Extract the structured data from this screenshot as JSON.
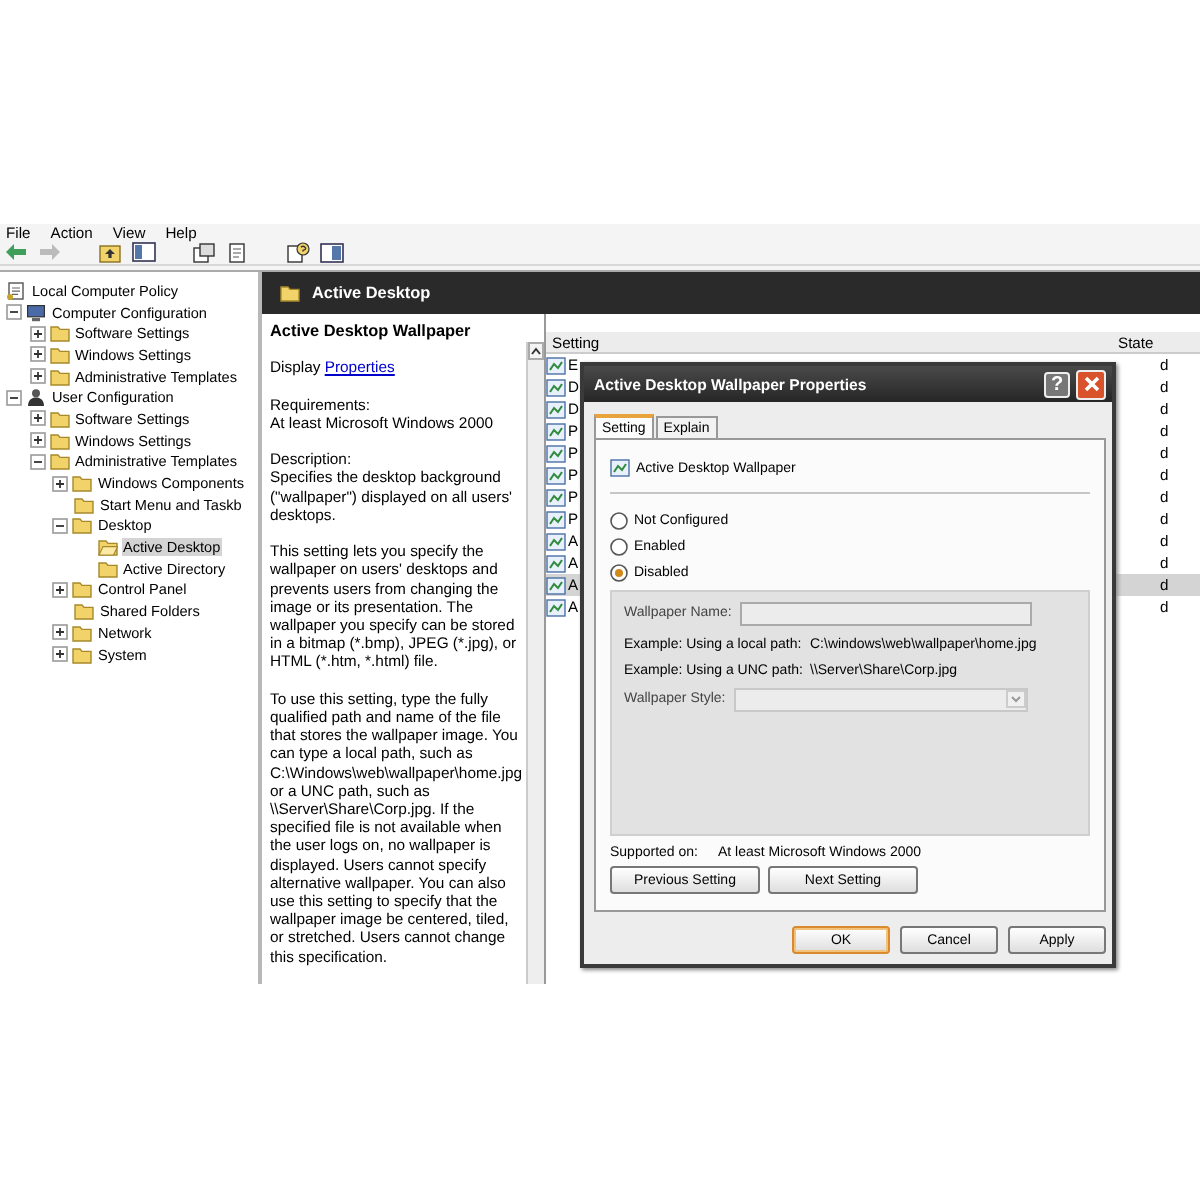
{
  "menu": [
    "File",
    "Action",
    "View",
    "Help"
  ],
  "tree": [
    {
      "label": "Local Computer Policy",
      "kind": "policy",
      "selected": false,
      "children": [
        {
          "label": "Computer Configuration",
          "kind": "computer",
          "selected": false,
          "expanded": true,
          "children": [
            {
              "label": "Software Settings",
              "kind": "folder",
              "selected": false,
              "expanded": false
            },
            {
              "label": "Windows Settings",
              "kind": "folder",
              "selected": false,
              "expanded": false
            },
            {
              "label": "Administrative Templates",
              "kind": "folder",
              "selected": false,
              "expanded": false
            }
          ]
        },
        {
          "label": "User Configuration",
          "kind": "user",
          "selected": false,
          "expanded": true,
          "children": [
            {
              "label": "Software Settings",
              "kind": "folder",
              "selected": false,
              "expanded": false
            },
            {
              "label": "Windows Settings",
              "kind": "folder",
              "selected": false,
              "expanded": false
            },
            {
              "label": "Administrative Templates",
              "kind": "folder",
              "selected": false,
              "expanded": true,
              "children": [
                {
                  "label": "Windows Components",
                  "kind": "folder",
                  "selected": false,
                  "expanded": false
                },
                {
                  "label": "Start Menu and Taskb",
                  "kind": "folder",
                  "selected": false
                },
                {
                  "label": "Desktop",
                  "kind": "folder",
                  "selected": false,
                  "expanded": true,
                  "children": [
                    {
                      "label": "Active Desktop",
                      "kind": "folder",
                      "selected": true
                    },
                    {
                      "label": "Active Directory",
                      "kind": "folder",
                      "selected": false
                    }
                  ]
                },
                {
                  "label": "Control Panel",
                  "kind": "folder",
                  "selected": false,
                  "expanded": false
                },
                {
                  "label": "Shared Folders",
                  "kind": "folder",
                  "selected": false
                },
                {
                  "label": "Network",
                  "kind": "folder",
                  "selected": false,
                  "expanded": false
                },
                {
                  "label": "System",
                  "kind": "folder",
                  "selected": false,
                  "expanded": false
                }
              ]
            }
          ]
        }
      ]
    }
  ],
  "header": {
    "title": "Active Desktop"
  },
  "description": {
    "title": "Active Desktop Wallpaper",
    "display_label": "Display",
    "display_link": "Properties",
    "requirements_label": "Requirements:",
    "requirements": "At least Microsoft Windows 2000",
    "description_label": "Description:",
    "paragraphs": [
      "Specifies the desktop background (\"wallpaper\") displayed on all users' desktops.",
      "This setting lets you specify the wallpaper on users' desktops and prevents users from changing the image or its presentation. The wallpaper you specify can be stored in a bitmap (*.bmp), JPEG (*.jpg), or HTML (*.htm, *.html) file.",
      "To use this setting, type the fully qualified path and name of the file that stores the wallpaper image. You can type a local path, such as C:\\Windows\\web\\wallpaper\\home.jpg or a UNC path, such as \\\\Server\\Share\\Corp.jpg. If the specified file is not available when the user logs on, no wallpaper is displayed. Users cannot specify alternative wallpaper. You can also use this setting to specify that the wallpaper image be centered, tiled, or stretched. Users cannot change this specification."
    ]
  },
  "list": {
    "columns": [
      "Setting",
      "State"
    ],
    "rows": [
      {
        "setting": "E",
        "state": "d",
        "selected": false
      },
      {
        "setting": "D",
        "state": "d",
        "selected": false
      },
      {
        "setting": "D",
        "state": "d",
        "selected": false
      },
      {
        "setting": "P",
        "state": "d",
        "selected": false
      },
      {
        "setting": "P",
        "state": "d",
        "selected": false
      },
      {
        "setting": "P",
        "state": "d",
        "selected": false
      },
      {
        "setting": "P",
        "state": "d",
        "selected": false
      },
      {
        "setting": "P",
        "state": "d",
        "selected": false
      },
      {
        "setting": "A",
        "state": "d",
        "selected": false
      },
      {
        "setting": "A",
        "state": "d",
        "selected": false
      },
      {
        "setting": "A",
        "state": "d",
        "selected": true
      },
      {
        "setting": "A",
        "state": "d",
        "selected": false
      }
    ]
  },
  "dialog": {
    "title": "Active Desktop Wallpaper Properties",
    "help_glyph": "?",
    "tabs": [
      {
        "label": "Setting",
        "selected": true
      },
      {
        "label": "Explain",
        "selected": false
      }
    ],
    "setting_name": "Active Desktop Wallpaper",
    "options": [
      {
        "label": "Not Configured",
        "selected": false
      },
      {
        "label": "Enabled",
        "selected": false
      },
      {
        "label": "Disabled",
        "selected": true
      }
    ],
    "fields_disabled": true,
    "name_label": "Wallpaper Name:",
    "examples": [
      {
        "label": "Example: Using a local path:",
        "value": "C:\\windows\\web\\wallpaper\\home.jpg"
      },
      {
        "label": "Example: Using a UNC path:",
        "value": "\\\\Server\\Share\\Corp.jpg"
      }
    ],
    "style_label": "Wallpaper Style:",
    "supported_label": "Supported on:",
    "supported_value": "At least Microsoft Windows 2000",
    "nav_buttons": [
      "Previous Setting",
      "Next Setting"
    ],
    "buttons": [
      {
        "label": "OK",
        "default": true
      },
      {
        "label": "Cancel",
        "default": false
      },
      {
        "label": "Apply",
        "default": false
      }
    ]
  }
}
